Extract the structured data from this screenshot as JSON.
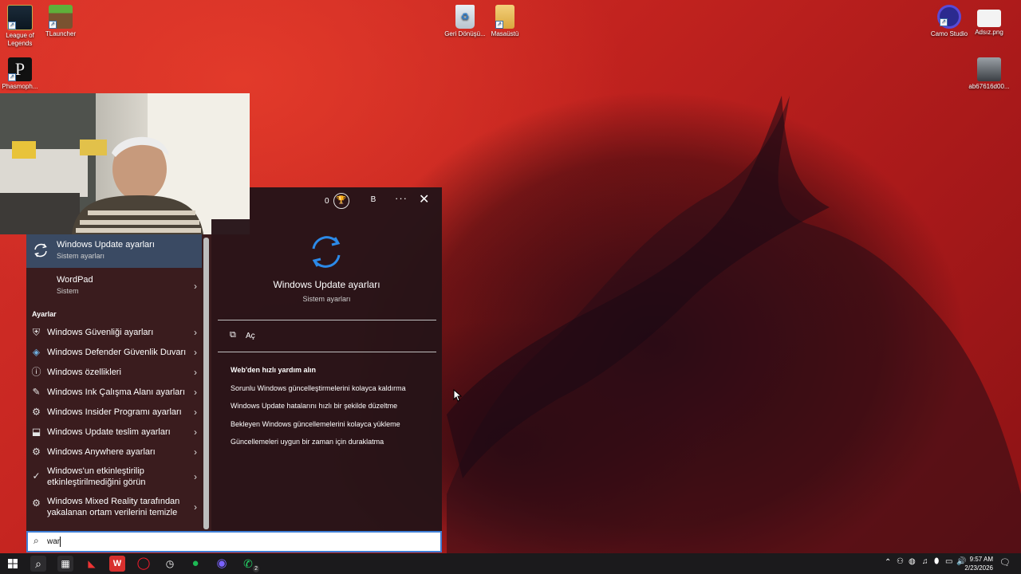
{
  "desktop": {
    "icons": [
      {
        "label": "League of Legends"
      },
      {
        "label": "TLauncher"
      },
      {
        "label": "Phasmoph..."
      },
      {
        "label": "Geri Dönüşü..."
      },
      {
        "label": "Masaüstü"
      },
      {
        "label": "Camo Studio"
      },
      {
        "label": "Adsız.png"
      },
      {
        "label": "ab67616d00..."
      }
    ]
  },
  "start_menu": {
    "best_match": {
      "title": "Windows Update ayarları",
      "subtitle": "Sistem ayarları"
    },
    "apps": [
      {
        "title": "WordPad",
        "subtitle": "Sistem"
      }
    ],
    "section_label": "Ayarlar",
    "settings_items": [
      {
        "label": "Windows Güvenliği ayarları",
        "icon": "shield-icon"
      },
      {
        "label": "Windows Defender Güvenlik Duvarı",
        "icon": "firewall-icon"
      },
      {
        "label": "Windows özellikleri",
        "icon": "info-icon"
      },
      {
        "label": "Windows Ink Çalışma Alanı ayarları",
        "icon": "pen-icon"
      },
      {
        "label": "Windows Insider Programı ayarları",
        "icon": "gear-icon"
      },
      {
        "label": "Windows Update teslim ayarları",
        "icon": "delivery-icon"
      },
      {
        "label": "Windows Anywhere ayarları",
        "icon": "gear-icon"
      },
      {
        "label_line1": "Windows'un etkinleştirilip",
        "label_line2": "etkinleştirilmediğini görün",
        "icon": "check-circle-icon"
      },
      {
        "label_line1": "Windows Mixed Reality tarafından",
        "label_line2": "yakalanan ortam verilerini temizle",
        "icon": "gear-icon"
      }
    ],
    "header": {
      "points": "0",
      "user_initial": "B"
    },
    "detail": {
      "title": "Windows Update ayarları",
      "subtitle": "Sistem ayarları",
      "open_label": "Aç",
      "web_heading": "Web'den hızlı yardım alın",
      "web_links": [
        "Sorunlu Windows güncelleştirmelerini kolayca kaldırma",
        "Windows Update hatalarını hızlı bir şekilde düzeltme",
        "Bekleyen Windows güncellemelerini kolayca yükleme",
        "Güncellemeleri uygun bir zaman için duraklatma"
      ]
    },
    "search": {
      "value": "war"
    }
  },
  "taskbar": {
    "time": "9:57 AM",
    "date": "2/23/2026",
    "whatsapp_badge": "2"
  },
  "colors": {
    "accent": "#3f7fd6",
    "update_icon": "#2c8ae8",
    "selected_row": "#3a4a63"
  }
}
